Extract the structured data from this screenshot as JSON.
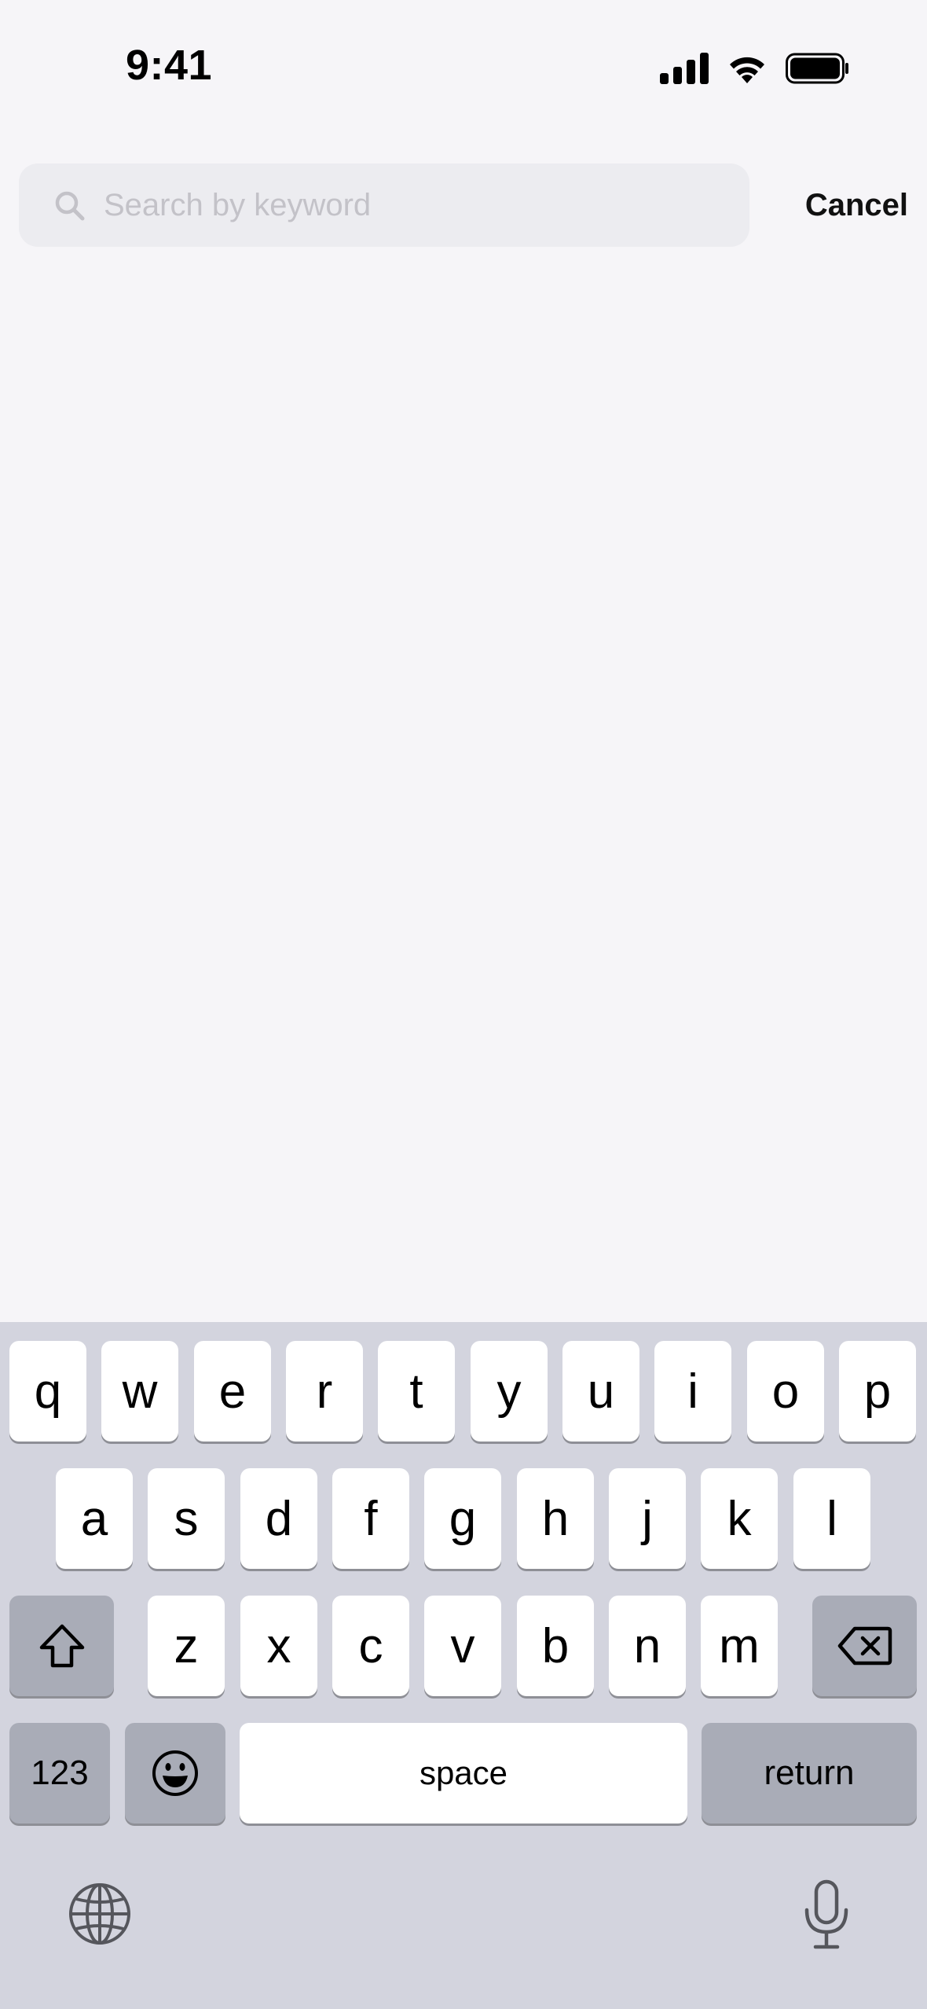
{
  "status_bar": {
    "time": "9:41",
    "icons": [
      "cellular-signal-icon",
      "wifi-icon",
      "battery-icon"
    ]
  },
  "search": {
    "placeholder": "Search by keyword",
    "value": "",
    "icon": "search-icon",
    "cancel_label": "Cancel"
  },
  "keyboard": {
    "row1": [
      "q",
      "w",
      "e",
      "r",
      "t",
      "y",
      "u",
      "i",
      "o",
      "p"
    ],
    "row2": [
      "a",
      "s",
      "d",
      "f",
      "g",
      "h",
      "j",
      "k",
      "l"
    ],
    "row3": [
      "z",
      "x",
      "c",
      "v",
      "b",
      "n",
      "m"
    ],
    "shift_icon": "shift-icon",
    "delete_icon": "delete-icon",
    "numbers_label": "123",
    "emoji_icon": "emoji-icon",
    "space_label": "space",
    "return_label": "return",
    "globe_icon": "globe-icon",
    "mic_icon": "microphone-icon"
  },
  "colors": {
    "background": "#f6f5f8",
    "search_field": "#ececf0",
    "keyboard_bg": "#d3d4de",
    "key_light": "#ffffff",
    "key_dark": "#a9acb7",
    "placeholder": "#c3c2c8"
  }
}
